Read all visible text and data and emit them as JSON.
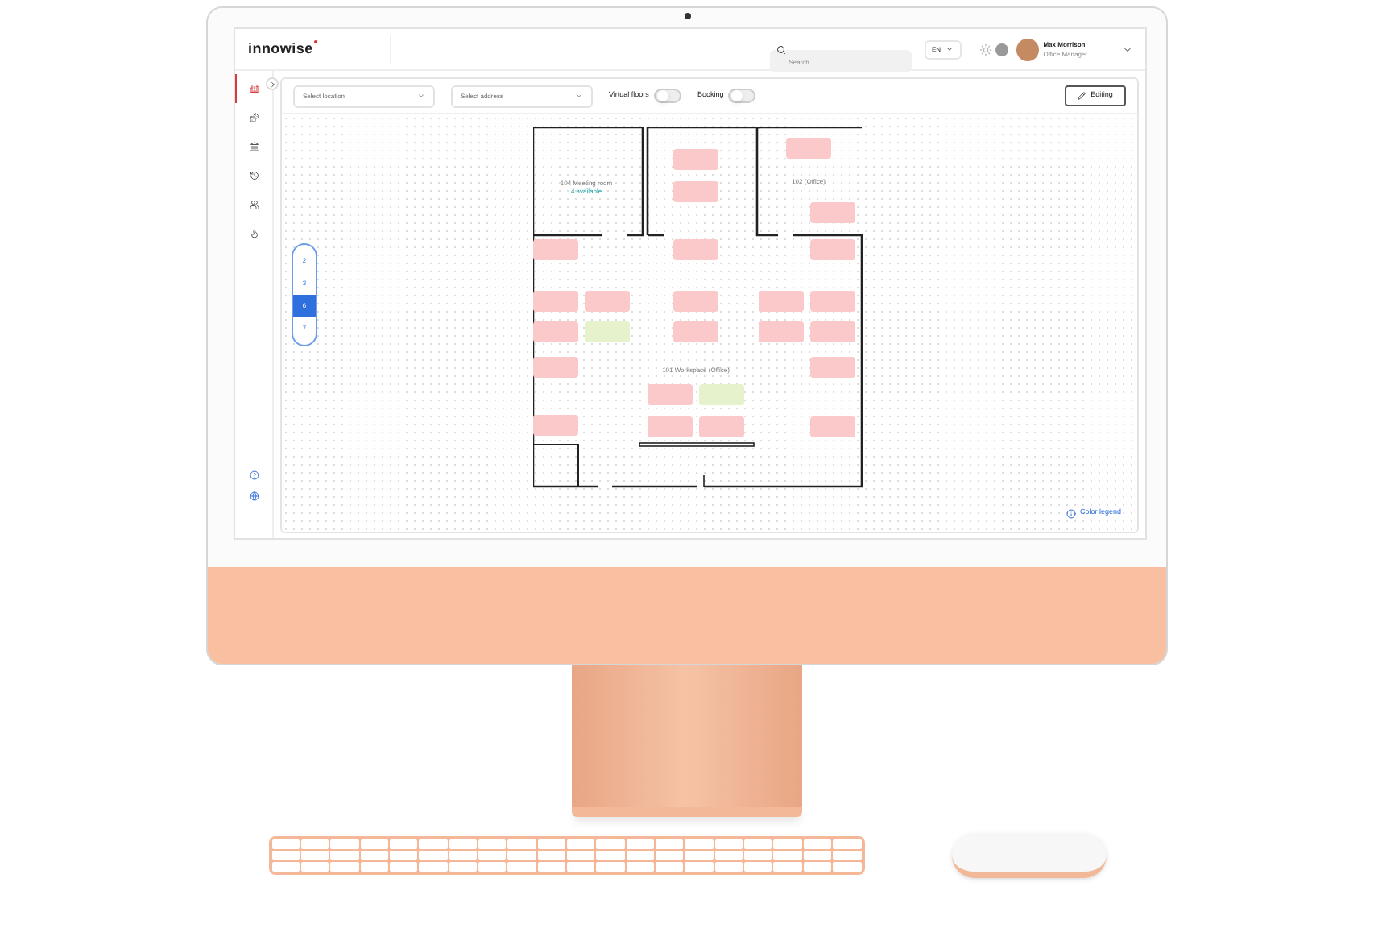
{
  "header": {
    "logo": "innowise",
    "search": {
      "placeholder": "Search"
    },
    "language": "EN",
    "user": {
      "name": "Max Morrison",
      "role": "Office Manager"
    }
  },
  "sidebar": {
    "items": [
      {
        "kind": "building",
        "selected": true
      },
      {
        "kind": "dice",
        "selected": false
      },
      {
        "kind": "bank",
        "selected": false
      },
      {
        "kind": "history",
        "selected": false
      },
      {
        "kind": "users",
        "selected": false
      },
      {
        "kind": "flame",
        "selected": false
      }
    ],
    "bottom_items": [
      {
        "kind": "help"
      },
      {
        "kind": "globe"
      }
    ]
  },
  "toolbar": {
    "location": {
      "placeholder": "Select location"
    },
    "address": {
      "placeholder": "Select address"
    },
    "toggles": [
      {
        "label": "Virtual floors",
        "on": false
      },
      {
        "label": "Booking",
        "on": false
      }
    ],
    "edit_button": "Editing"
  },
  "floors": [
    {
      "label": "2",
      "selected": false
    },
    {
      "label": "3",
      "selected": false
    },
    {
      "label": "6",
      "selected": true
    },
    {
      "label": "7",
      "selected": false
    }
  ],
  "rooms": [
    {
      "name": "104 Meeting room",
      "status": "4 available"
    },
    {
      "name": "102 (Office)"
    },
    {
      "name": "101 Workspace (Office)"
    }
  ],
  "desks": [
    {
      "kind": "booked"
    },
    {
      "kind": "booked"
    },
    {
      "kind": "booked"
    },
    {
      "kind": "booked"
    },
    {
      "kind": "booked"
    },
    {
      "kind": "booked"
    },
    {
      "kind": "booked"
    },
    {
      "kind": "booked"
    },
    {
      "kind": "booked"
    },
    {
      "kind": "booked"
    },
    {
      "kind": "booked"
    },
    {
      "kind": "booked"
    },
    {
      "kind": "booked"
    },
    {
      "kind": "available"
    },
    {
      "kind": "booked"
    },
    {
      "kind": "booked"
    },
    {
      "kind": "booked"
    },
    {
      "kind": "booked"
    },
    {
      "kind": "booked"
    },
    {
      "kind": "booked"
    },
    {
      "kind": "available"
    },
    {
      "kind": "booked"
    },
    {
      "kind": "booked"
    },
    {
      "kind": "booked"
    },
    {
      "kind": "booked"
    }
  ],
  "legend_button": "Color legend"
}
